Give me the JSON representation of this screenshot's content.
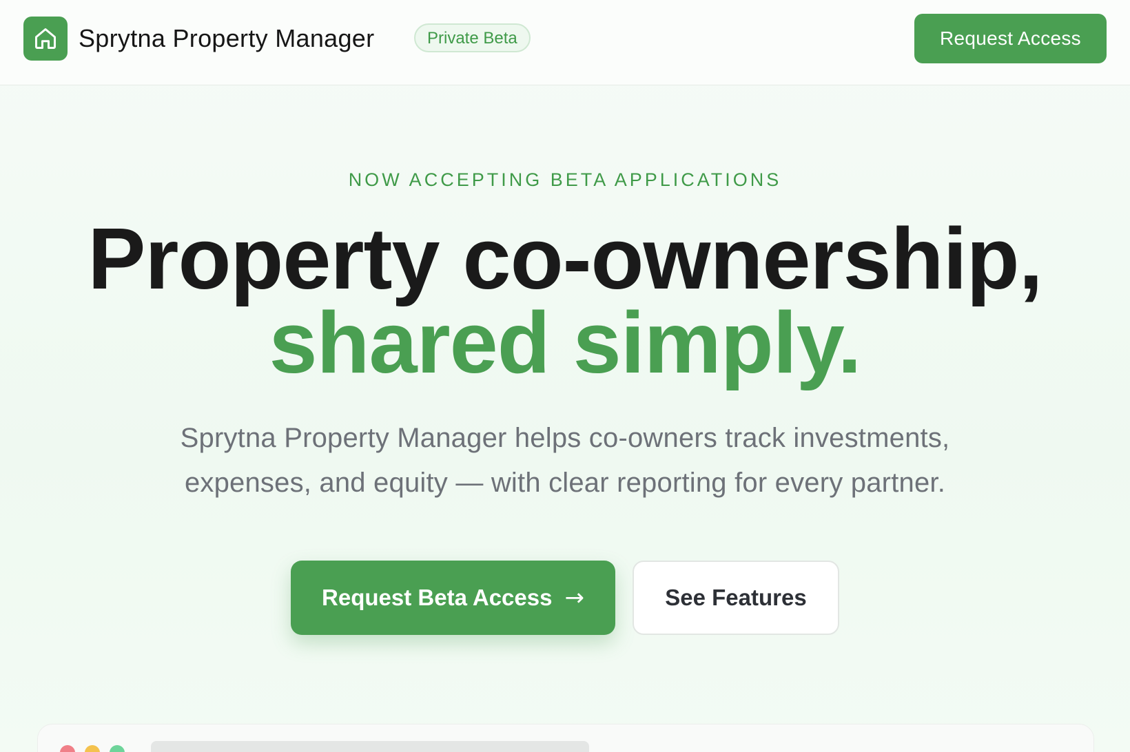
{
  "header": {
    "brand_name": "Sprytna Property Manager",
    "badge": "Private Beta",
    "cta_label": "Request Access",
    "logo_icon": "home-icon"
  },
  "hero": {
    "eyebrow": "NOW ACCEPTING BETA APPLICATIONS",
    "headline_line1": "Property co-ownership,",
    "headline_line2": "shared simply.",
    "subtitle_line1": "Sprytna Property Manager helps co-owners track investments,",
    "subtitle_line2": "expenses, and equity — with clear reporting for every partner.",
    "primary_button": "Request Beta Access",
    "primary_arrow": "→",
    "secondary_button": "See Features"
  },
  "colors": {
    "accent": "#4a9f52",
    "text_dark": "#1a1a1a",
    "text_muted": "#6d7178",
    "background": "#f4fbf5"
  },
  "preview": {
    "window_controls": [
      "red-dot",
      "yellow-dot",
      "green-dot"
    ]
  }
}
